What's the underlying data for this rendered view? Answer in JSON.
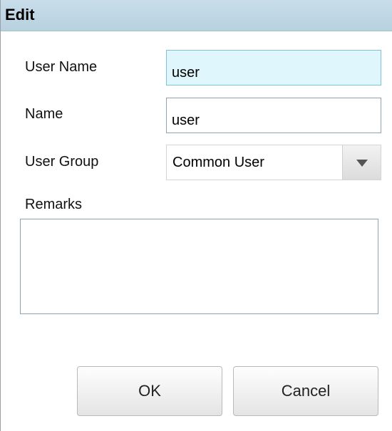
{
  "dialog": {
    "title": "Edit"
  },
  "form": {
    "username_label": "User Name",
    "username_value": "user",
    "name_label": "Name",
    "name_value": "user",
    "group_label": "User Group",
    "group_value": "Common User",
    "remarks_label": "Remarks",
    "remarks_value": ""
  },
  "buttons": {
    "ok_label": "OK",
    "cancel_label": "Cancel"
  },
  "icons": {
    "dropdown": "chevron-down-icon"
  },
  "colors": {
    "titlebar": "#c2d9e6",
    "focused_field": "#dff6fd",
    "field_border": "#8ea3b3"
  }
}
